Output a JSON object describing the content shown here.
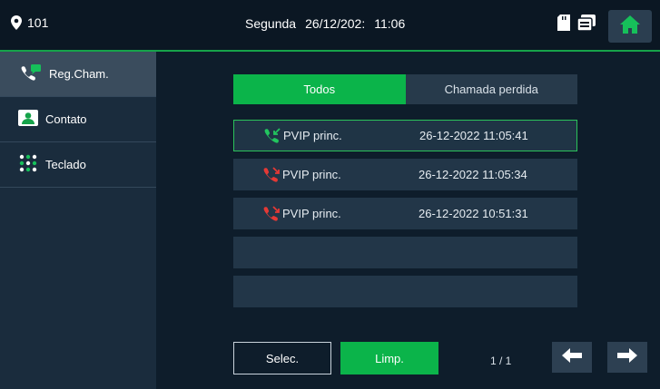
{
  "header": {
    "location": "101",
    "day": "Segunda",
    "date": "26/12/202:",
    "time": "11:06"
  },
  "icons": {
    "location": "map-pin-icon",
    "sd_card": "sd-card-icon",
    "messages": "message-stack-icon",
    "home": "home-icon"
  },
  "sidebar": {
    "items": [
      {
        "label": "Reg.Cham.",
        "icon": "call-log-icon",
        "active": true
      },
      {
        "label": "Contato",
        "icon": "contact-icon",
        "active": false
      },
      {
        "label": "Teclado",
        "icon": "keypad-icon",
        "active": false
      }
    ]
  },
  "tabs": [
    {
      "label": "Todos",
      "active": true
    },
    {
      "label": "Chamada perdida",
      "active": false
    }
  ],
  "calls": [
    {
      "name": "PVIP princ.",
      "timestamp": "26-12-2022 11:05:41",
      "status": "answered",
      "icon": "call-answered-icon"
    },
    {
      "name": "PVIP princ.",
      "timestamp": "26-12-2022 11:05:34",
      "status": "missed",
      "icon": "call-missed-icon"
    },
    {
      "name": "PVIP princ.",
      "timestamp": "26-12-2022 10:51:31",
      "status": "missed",
      "icon": "call-missed-icon"
    }
  ],
  "footer": {
    "select_label": "Selec.",
    "clear_label": "Limp.",
    "page": "1 / 1"
  },
  "colors": {
    "accent": "#0bb44a",
    "answered": "#22c55e",
    "missed": "#e53935",
    "background": "#0e1d2b",
    "sidebar": "#1a2c3d"
  }
}
